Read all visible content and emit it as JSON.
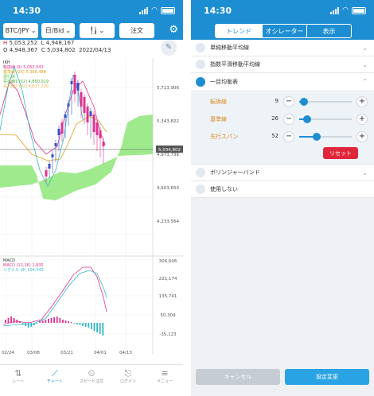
{
  "status": {
    "time": "14:30"
  },
  "chart_screen": {
    "toolbar": {
      "pair": "BTC/JPY",
      "price_type": "日/Bid",
      "chart_type_icon": "candlestick-icon",
      "order": "注文"
    },
    "quote": {
      "h_key": "H",
      "h": "5,053,252",
      "l_key": "L",
      "l": "4,948,167",
      "o_key": "O",
      "o": "4,948,367",
      "c_key": "C",
      "c": "5,034,802",
      "date": "2022/04/13"
    },
    "ichimoku_legend": {
      "title": "IKH",
      "rows": [
        {
          "label": "転換線 (9)",
          "value": "5,052,543",
          "color": "#e0338f"
        },
        {
          "label": "基準線 (26)",
          "value": "5,366,488",
          "color": "#e0a21f"
        },
        {
          "label": "遅行線",
          "value": "",
          "color": "#66c44f"
        },
        {
          "label": "先行線1 (52)",
          "value": "4,650,019",
          "color": "#4aa832"
        },
        {
          "label": "先行線2 (52)",
          "value": "4,617,230",
          "color": "#e9b64a"
        }
      ]
    },
    "price_axis": [
      "5,713,906",
      "5,343,822",
      "4,973,738",
      "4,603,650",
      "4,233,564"
    ],
    "current_price": "5,034,802",
    "macd_axis": [
      "306,606",
      "221,174",
      "135,741",
      "50,309",
      "-35,123"
    ],
    "macd_legend": {
      "title": "MACD",
      "rows": [
        {
          "label": "MACD (12,26)",
          "value": "1,935",
          "color": "#e0338f"
        },
        {
          "label": "シグナル (9)",
          "value": "104,543",
          "color": "#36b8c6"
        }
      ]
    },
    "x_axis": [
      "02/24",
      "03/08",
      "03/21",
      "04/01",
      "04/13"
    ],
    "colors": {
      "up": "#3b4ec9",
      "down": "#e0338f",
      "cloud": "#8fe67a"
    },
    "nav": [
      {
        "label": "レート",
        "icon": "rate-icon"
      },
      {
        "label": "チャート",
        "icon": "chart-icon"
      },
      {
        "label": "スピード注文",
        "icon": "speed-order-icon"
      },
      {
        "label": "ログイン",
        "icon": "login-icon"
      },
      {
        "label": "メニュー",
        "icon": "menu-icon"
      }
    ]
  },
  "settings_screen": {
    "tabs": [
      "トレンド",
      "オシレーター",
      "表示"
    ],
    "items": [
      {
        "label": "単純移動平均線",
        "selected": false
      },
      {
        "label": "指数平滑移動平均線",
        "selected": false
      },
      {
        "label": "一目均衡表",
        "selected": true
      },
      {
        "label": "ボリンジャーバンド",
        "selected": false
      },
      {
        "label": "使用しない",
        "selected": false
      }
    ],
    "params": [
      {
        "label": "転換線",
        "value": "9",
        "ratio": 0.1
      },
      {
        "label": "基準線",
        "value": "26",
        "ratio": 0.16
      },
      {
        "label": "先行スパン",
        "value": "52",
        "ratio": 0.32
      }
    ],
    "reset": "リセット",
    "cancel": "キャンセル",
    "apply": "設定変更"
  }
}
